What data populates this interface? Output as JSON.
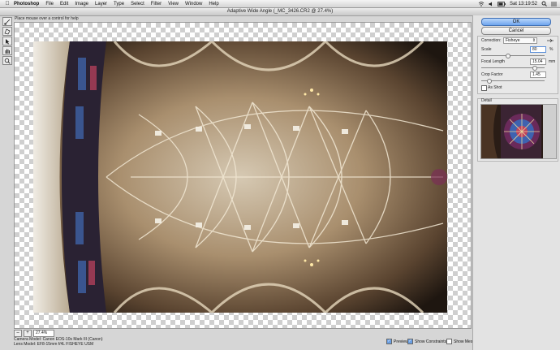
{
  "menubar": {
    "app_name": "Photoshop",
    "items": [
      "File",
      "Edit",
      "Image",
      "Layer",
      "Type",
      "Select",
      "Filter",
      "View",
      "Window",
      "Help"
    ],
    "clock": "Sat 13:19:52"
  },
  "dialog": {
    "title": "Adaptive Wide Angle (_MC_3426.CR2 @ 27.4%)",
    "hint": "Place mouse over a control for help"
  },
  "buttons": {
    "ok": "OK",
    "cancel": "Cancel"
  },
  "settings": {
    "correction_label": "Correction:",
    "correction_value": "Fisheye",
    "scale_label": "Scale",
    "scale_value": "80",
    "scale_unit": "%",
    "scale_level": 0.4,
    "focal_length_label": "Focal Length",
    "focal_length_value": "15.04",
    "focal_length_unit": "mm",
    "focal_length_level": 0.85,
    "crop_factor_label": "Crop Factor",
    "crop_factor_value": "1.45",
    "crop_factor_level": 0.1,
    "as_shot_label": "As Shot",
    "as_shot_checked": false
  },
  "detail_label": "Detail",
  "zoom": {
    "value": "27.4%",
    "minus": "–",
    "plus": "+"
  },
  "camera": {
    "camera_model": "Camera Model: Canon EOS-10s Mark III (Canon)",
    "lens_model": "Lens Model: EF8-15mm f/4L FISHEYE USM"
  },
  "options": {
    "preview": "Preview",
    "show_constraints": "Show Constraints",
    "show_mesh": "Show Mesh",
    "preview_checked": true,
    "show_constraints_checked": true,
    "show_mesh_checked": false
  },
  "icons": {
    "apple": "apple-icon",
    "constraint_tool": "constraint-tool-icon",
    "polygon_tool": "polygon-constraint-tool-icon",
    "move_tool": "move-tool-icon",
    "hand_tool": "hand-tool-icon",
    "zoom_tool": "zoom-tool-icon"
  },
  "colors": {
    "ok_button": "#6ea5ee",
    "panel": "#e3e3e3"
  }
}
